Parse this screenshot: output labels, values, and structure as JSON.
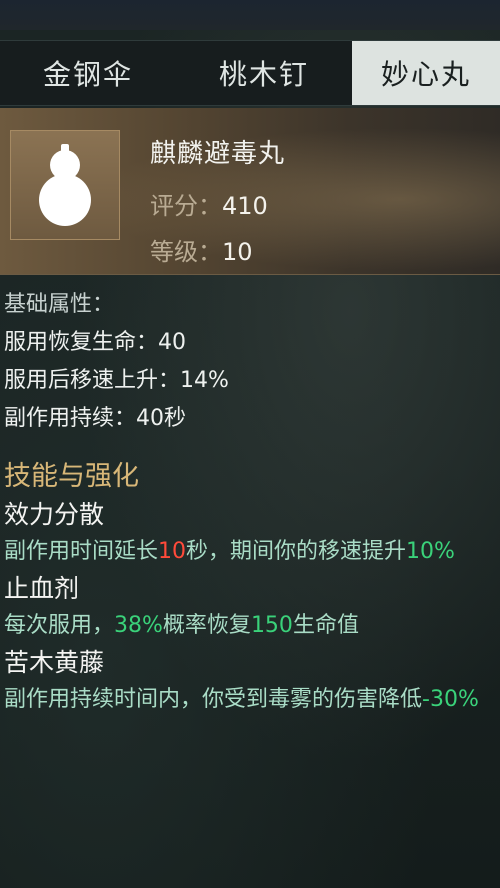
{
  "tabs": [
    {
      "label": "金钢伞",
      "active": false
    },
    {
      "label": "桃木钉",
      "active": false
    },
    {
      "label": "妙心丸",
      "active": true
    }
  ],
  "item": {
    "name": "麒麟避毒丸",
    "icon": "gourd-icon",
    "score_label": "评分：",
    "score_value": "410",
    "level_label": "等级：",
    "level_value": "10"
  },
  "basic": {
    "title": "基础属性：",
    "lines": [
      "服用恢复生命：40",
      "服用后移速上升：14%",
      "副作用持续：40秒"
    ]
  },
  "skills": {
    "title": "技能与强化",
    "items": [
      {
        "name": "效力分散",
        "desc": [
          {
            "t": "副作用时间延长",
            "c": "n"
          },
          {
            "t": "10",
            "c": "r"
          },
          {
            "t": "秒，期间你的移速提升",
            "c": "n"
          },
          {
            "t": "10%",
            "c": "g"
          }
        ]
      },
      {
        "name": "止血剂",
        "desc": [
          {
            "t": "每次服用，",
            "c": "n"
          },
          {
            "t": "38%",
            "c": "g"
          },
          {
            "t": "概率恢复",
            "c": "n"
          },
          {
            "t": "150",
            "c": "g"
          },
          {
            "t": "生命值",
            "c": "n"
          }
        ]
      },
      {
        "name": "苦木黄藤",
        "desc": [
          {
            "t": "副作用持续时间内，你受到毒雾的伤害降低",
            "c": "n"
          },
          {
            "t": "-30%",
            "c": "g"
          }
        ]
      }
    ]
  },
  "colors": {
    "highlight_red": "#ff4a3a",
    "highlight_green": "#3ad27a",
    "accent_gold": "#d8b778"
  }
}
